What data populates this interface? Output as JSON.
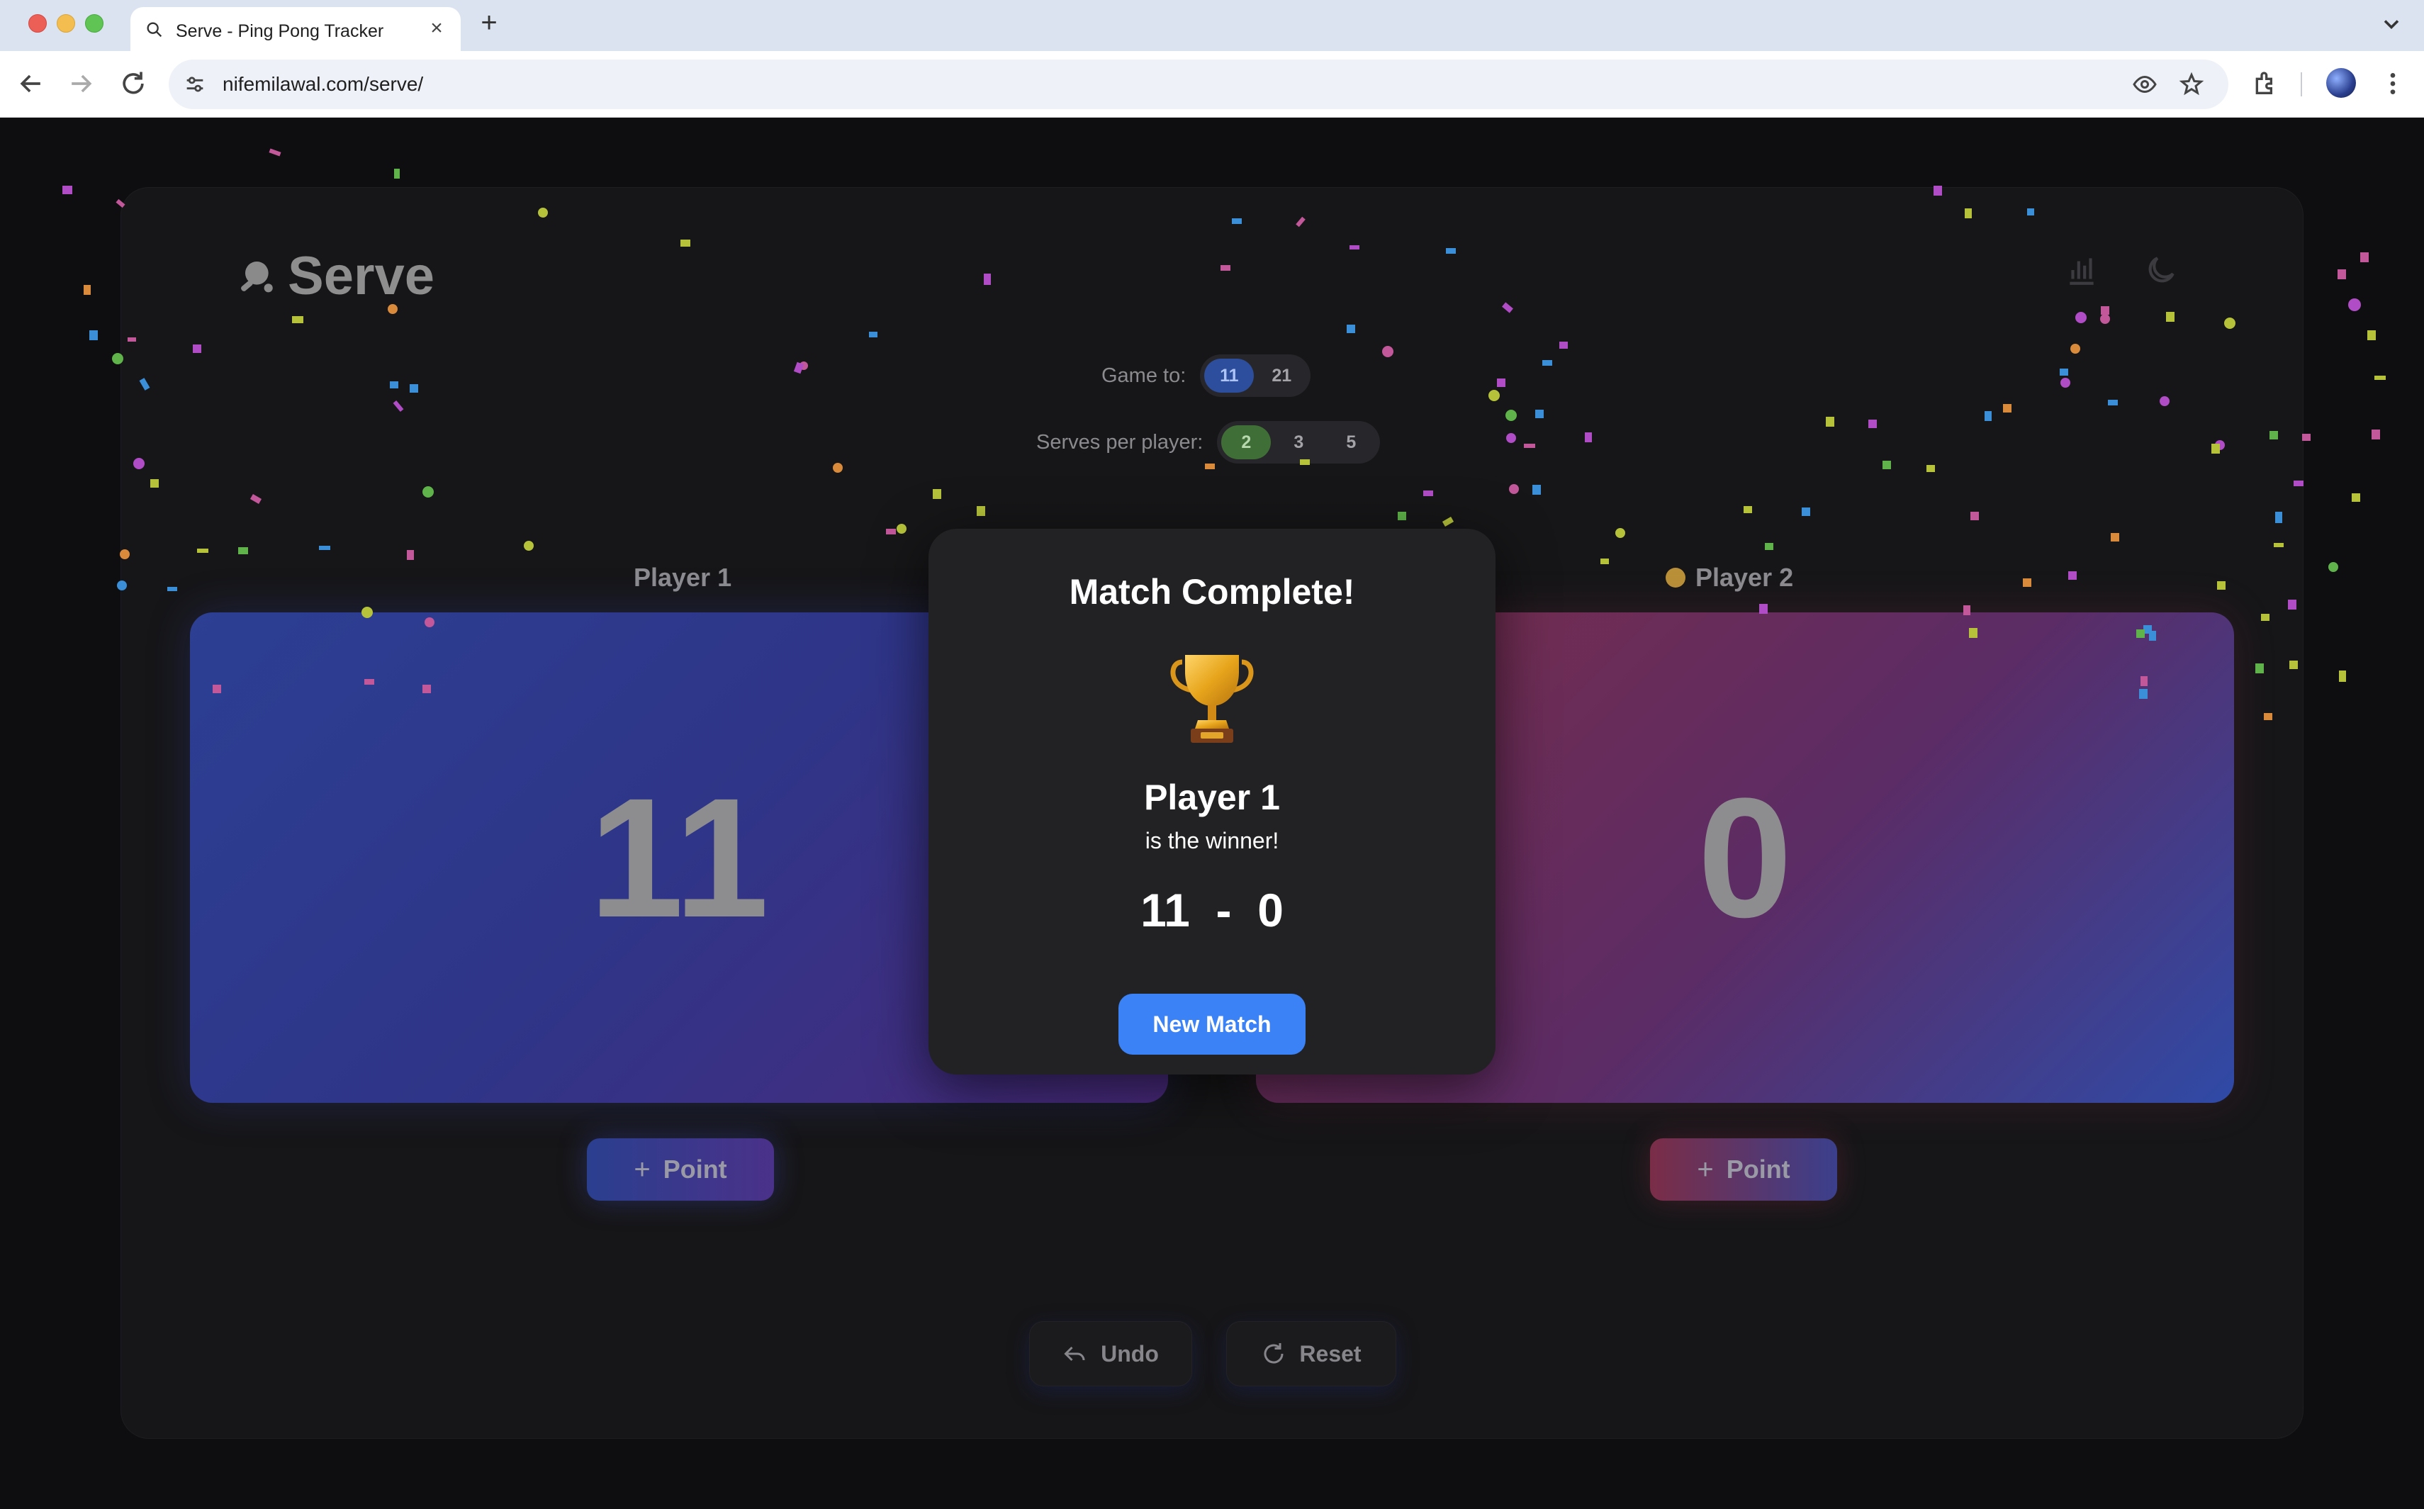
{
  "browser": {
    "tab_title": "Serve - Ping Pong Tracker",
    "url": "nifemilawal.com/serve/"
  },
  "app": {
    "name": "Serve"
  },
  "settings": {
    "game_to_label": "Game to:",
    "game_to_options": [
      "11",
      "21"
    ],
    "game_to_selected": "11",
    "serves_label": "Serves per player:",
    "serves_options": [
      "2",
      "3",
      "5"
    ],
    "serves_selected": "2"
  },
  "players": [
    {
      "name": "Player 1",
      "score": "11",
      "serving": false,
      "color": "#2c3f93"
    },
    {
      "name": "Player 2",
      "score": "0",
      "serving": true,
      "color": "#7a2d49"
    }
  ],
  "buttons": {
    "point_label": "Point",
    "undo_label": "Undo",
    "reset_label": "Reset"
  },
  "modal": {
    "title": "Match Complete!",
    "winner": "Player 1",
    "winner_sub": "is the winner!",
    "final_score": "11  -  0",
    "button_label": "New Match"
  },
  "colors": {
    "accent_blue": "#3b82f6",
    "serve_indicator": "#b99038"
  },
  "icons": {
    "logo": "ping-pong-paddle-icon",
    "stats": "bar-chart-icon",
    "theme": "moon-icon",
    "trophy": "trophy-icon"
  }
}
